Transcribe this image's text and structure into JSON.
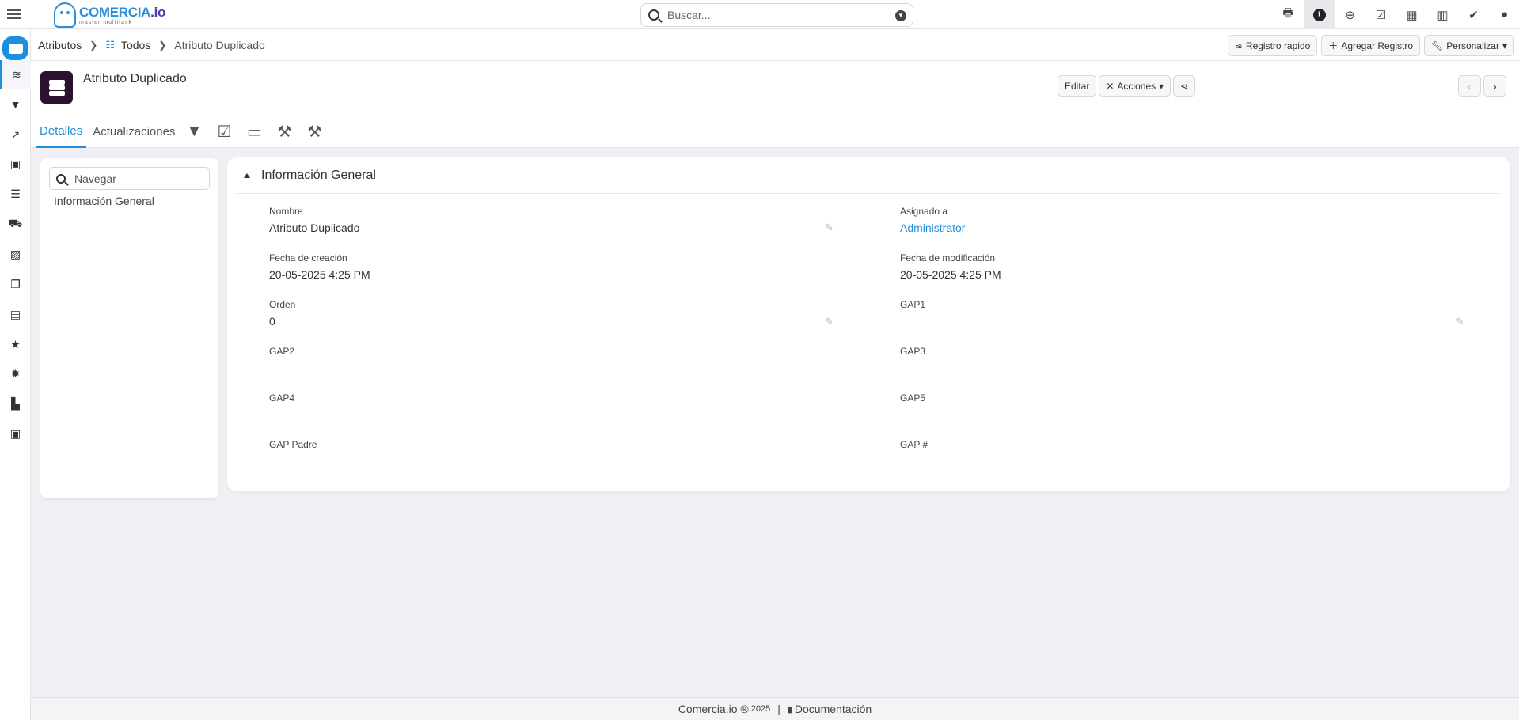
{
  "topbar": {
    "logo_name_1": "COMERCIA",
    "logo_name_2": ".io",
    "logo_tagline": "master multitask",
    "search_placeholder": "Buscar...",
    "icons": [
      "cash-register-icon",
      "alert-icon",
      "plus-circle-icon",
      "calendar-check-icon",
      "calendar-icon",
      "bar-chart-icon",
      "checkbox-icon",
      "user-icon"
    ]
  },
  "breadcrumb": {
    "module": "Atributos",
    "list": "Todos",
    "current": "Atributo Duplicado"
  },
  "toolbar": {
    "quick_record": "Registro rapido",
    "add_record": "Agregar Registro",
    "customize": "Personalizar"
  },
  "record": {
    "title": "Atributo Duplicado",
    "edit": "Editar",
    "actions": "Acciones"
  },
  "tabs": {
    "details": "Detalles",
    "updates": "Actualizaciones"
  },
  "navigator": {
    "placeholder": "Navegar",
    "items": [
      "Información General"
    ]
  },
  "section": {
    "title": "Información General",
    "fields": {
      "nombre": {
        "label": "Nombre",
        "value": "Atributo Duplicado"
      },
      "asignado": {
        "label": "Asignado a",
        "value": "Administrator"
      },
      "fecha_creacion": {
        "label": "Fecha de creación",
        "value": "20-05-2025 4:25 PM"
      },
      "fecha_modificacion": {
        "label": "Fecha de modificación",
        "value": "20-05-2025 4:25 PM"
      },
      "orden": {
        "label": "Orden",
        "value": "0"
      },
      "gap1": {
        "label": "GAP1",
        "value": ""
      },
      "gap2": {
        "label": "GAP2",
        "value": ""
      },
      "gap3": {
        "label": "GAP3",
        "value": ""
      },
      "gap4": {
        "label": "GAP4",
        "value": ""
      },
      "gap5": {
        "label": "GAP5",
        "value": ""
      },
      "gap_padre": {
        "label": "GAP Padre",
        "value": ""
      },
      "gap_num": {
        "label": "GAP #",
        "value": ""
      }
    }
  },
  "footer": {
    "brand": "Comercia.io ®",
    "year": "2025",
    "separator": "|",
    "docs": "Documentación"
  },
  "colors": {
    "accent": "#1e8fdd",
    "record_icon_bg": "#2a1330",
    "background": "#efeff4"
  }
}
